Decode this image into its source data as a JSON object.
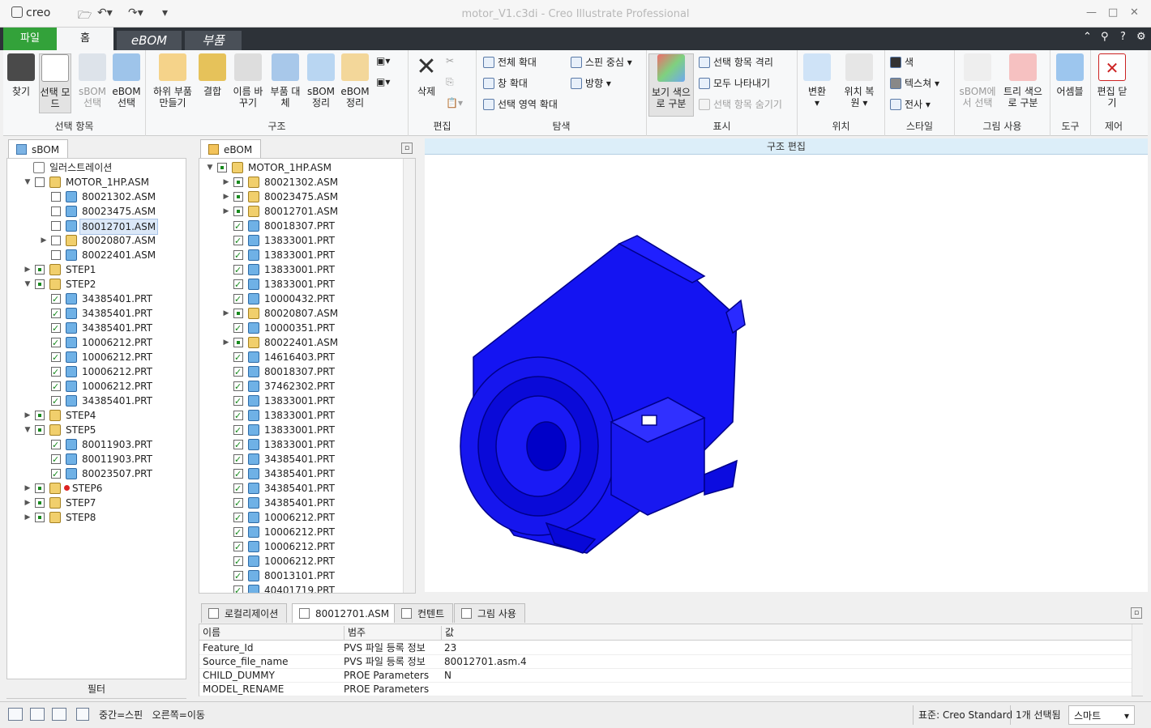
{
  "window": {
    "title": "motor_V1.c3di - Creo Illustrate Professional",
    "logo": "creo"
  },
  "tabs": [
    "파일",
    "홈",
    "eBOM",
    "부품"
  ],
  "ribbon": {
    "groups": [
      "선택 항목",
      "구조",
      "편집",
      "탐색",
      "표시",
      "위치",
      "스타일",
      "그림 사용",
      "도구",
      "제어"
    ],
    "buttons": {
      "find": "찾기",
      "select_mode": "선택 모\n드",
      "sbom_select": "sBOM\n선택",
      "ebom_select": "eBOM\n선택",
      "make_sub": "하위 부품\n만들기",
      "combine": "결합",
      "rename": "이름 바\n꾸기",
      "replace": "부품 대\n체",
      "sbom_arrange": "sBOM\n정리",
      "ebom_arrange": "eBOM\n정리",
      "delete": "삭제",
      "zoom_all": "전체 확대",
      "zoom_window": "창 확대",
      "zoom_selected": "선택 영역 확대",
      "spin_center": "스핀 중심",
      "orientation": "방향",
      "view_color": "보기 색으\n로 구분",
      "isolate": "선택 항목 격리",
      "show_all": "모두 나타내기",
      "hide_selected": "선택 항목 숨기기",
      "transform": "변환",
      "restore_pos": "위치 복\n원",
      "color": "색",
      "texture": "텍스쳐",
      "transfer": "전사",
      "select_in_sbom": "sBOM에\n서 선택",
      "tree_color": "트리 색으\n로 구분",
      "assembly": "어셈블",
      "close_edit": "편집 닫\n기"
    }
  },
  "sbom": {
    "tab": "sBOM",
    "rows": [
      {
        "label": "일러스트레이션",
        "level": 0,
        "tw": "",
        "cb": "",
        "icon": "stepi"
      },
      {
        "label": "MOTOR_1HP.ASM",
        "level": 1,
        "tw": "▼",
        "cb": "off",
        "icon": "asm"
      },
      {
        "label": "80021302.ASM",
        "level": 2,
        "tw": "",
        "cb": "off",
        "icon": "prt"
      },
      {
        "label": "80023475.ASM",
        "level": 2,
        "tw": "",
        "cb": "off",
        "icon": "prt"
      },
      {
        "label": "80012701.ASM",
        "level": 2,
        "tw": "",
        "cb": "off",
        "icon": "prt",
        "sel": true
      },
      {
        "label": "80020807.ASM",
        "level": 2,
        "tw": "▶",
        "cb": "off",
        "icon": "asm"
      },
      {
        "label": "80022401.ASM",
        "level": 2,
        "tw": "",
        "cb": "off",
        "icon": "prt"
      },
      {
        "label": "STEP1",
        "level": 1,
        "tw": "▶",
        "cb": "sq",
        "icon": "asm"
      },
      {
        "label": "STEP2",
        "level": 1,
        "tw": "▼",
        "cb": "sq",
        "icon": "asm"
      },
      {
        "label": "34385401.PRT",
        "level": 2,
        "tw": "",
        "cb": "on",
        "icon": "prt"
      },
      {
        "label": "34385401.PRT",
        "level": 2,
        "tw": "",
        "cb": "on",
        "icon": "prt"
      },
      {
        "label": "34385401.PRT",
        "level": 2,
        "tw": "",
        "cb": "on",
        "icon": "prt"
      },
      {
        "label": "10006212.PRT",
        "level": 2,
        "tw": "",
        "cb": "on",
        "icon": "prt"
      },
      {
        "label": "10006212.PRT",
        "level": 2,
        "tw": "",
        "cb": "on",
        "icon": "prt"
      },
      {
        "label": "10006212.PRT",
        "level": 2,
        "tw": "",
        "cb": "on",
        "icon": "prt"
      },
      {
        "label": "10006212.PRT",
        "level": 2,
        "tw": "",
        "cb": "on",
        "icon": "prt"
      },
      {
        "label": "34385401.PRT",
        "level": 2,
        "tw": "",
        "cb": "on",
        "icon": "prt"
      },
      {
        "label": "STEP4",
        "level": 1,
        "tw": "▶",
        "cb": "sq",
        "icon": "asm"
      },
      {
        "label": "STEP5",
        "level": 1,
        "tw": "▼",
        "cb": "sq",
        "icon": "asm"
      },
      {
        "label": "80011903.PRT",
        "level": 2,
        "tw": "",
        "cb": "on",
        "icon": "prt"
      },
      {
        "label": "80011903.PRT",
        "level": 2,
        "tw": "",
        "cb": "on",
        "icon": "prt"
      },
      {
        "label": "80023507.PRT",
        "level": 2,
        "tw": "",
        "cb": "on",
        "icon": "prt"
      },
      {
        "label": "STEP6",
        "level": 1,
        "tw": "▶",
        "cb": "sq",
        "icon": "asm",
        "dot": true
      },
      {
        "label": "STEP7",
        "level": 1,
        "tw": "▶",
        "cb": "sq",
        "icon": "asm"
      },
      {
        "label": "STEP8",
        "level": 1,
        "tw": "▶",
        "cb": "sq",
        "icon": "asm"
      }
    ],
    "filter": "필터"
  },
  "ebom": {
    "tab": "eBOM",
    "rows": [
      {
        "label": "MOTOR_1HP.ASM",
        "level": 0,
        "tw": "▼",
        "cb": "sq",
        "icon": "asm"
      },
      {
        "label": "80021302.ASM",
        "level": 1,
        "tw": "▶",
        "cb": "sq",
        "icon": "asm"
      },
      {
        "label": "80023475.ASM",
        "level": 1,
        "tw": "▶",
        "cb": "sq",
        "icon": "asm"
      },
      {
        "label": "80012701.ASM",
        "level": 1,
        "tw": "▶",
        "cb": "sq",
        "icon": "asm"
      },
      {
        "label": "80018307.PRT",
        "level": 1,
        "tw": "",
        "cb": "on",
        "icon": "prt"
      },
      {
        "label": "13833001.PRT",
        "level": 1,
        "tw": "",
        "cb": "on",
        "icon": "prt"
      },
      {
        "label": "13833001.PRT",
        "level": 1,
        "tw": "",
        "cb": "on",
        "icon": "prt"
      },
      {
        "label": "13833001.PRT",
        "level": 1,
        "tw": "",
        "cb": "on",
        "icon": "prt"
      },
      {
        "label": "13833001.PRT",
        "level": 1,
        "tw": "",
        "cb": "on",
        "icon": "prt"
      },
      {
        "label": "10000432.PRT",
        "level": 1,
        "tw": "",
        "cb": "on",
        "icon": "prt"
      },
      {
        "label": "80020807.ASM",
        "level": 1,
        "tw": "▶",
        "cb": "sq",
        "icon": "asm"
      },
      {
        "label": "10000351.PRT",
        "level": 1,
        "tw": "",
        "cb": "on",
        "icon": "prt"
      },
      {
        "label": "80022401.ASM",
        "level": 1,
        "tw": "▶",
        "cb": "sq",
        "icon": "asm"
      },
      {
        "label": "14616403.PRT",
        "level": 1,
        "tw": "",
        "cb": "on",
        "icon": "prt"
      },
      {
        "label": "80018307.PRT",
        "level": 1,
        "tw": "",
        "cb": "on",
        "icon": "prt"
      },
      {
        "label": "37462302.PRT",
        "level": 1,
        "tw": "",
        "cb": "on",
        "icon": "prt"
      },
      {
        "label": "13833001.PRT",
        "level": 1,
        "tw": "",
        "cb": "on",
        "icon": "prt"
      },
      {
        "label": "13833001.PRT",
        "level": 1,
        "tw": "",
        "cb": "on",
        "icon": "prt"
      },
      {
        "label": "13833001.PRT",
        "level": 1,
        "tw": "",
        "cb": "on",
        "icon": "prt"
      },
      {
        "label": "13833001.PRT",
        "level": 1,
        "tw": "",
        "cb": "on",
        "icon": "prt"
      },
      {
        "label": "34385401.PRT",
        "level": 1,
        "tw": "",
        "cb": "on",
        "icon": "prt"
      },
      {
        "label": "34385401.PRT",
        "level": 1,
        "tw": "",
        "cb": "on",
        "icon": "prt"
      },
      {
        "label": "34385401.PRT",
        "level": 1,
        "tw": "",
        "cb": "on",
        "icon": "prt"
      },
      {
        "label": "34385401.PRT",
        "level": 1,
        "tw": "",
        "cb": "on",
        "icon": "prt"
      },
      {
        "label": "10006212.PRT",
        "level": 1,
        "tw": "",
        "cb": "on",
        "icon": "prt"
      },
      {
        "label": "10006212.PRT",
        "level": 1,
        "tw": "",
        "cb": "on",
        "icon": "prt"
      },
      {
        "label": "10006212.PRT",
        "level": 1,
        "tw": "",
        "cb": "on",
        "icon": "prt"
      },
      {
        "label": "10006212.PRT",
        "level": 1,
        "tw": "",
        "cb": "on",
        "icon": "prt"
      },
      {
        "label": "80013101.PRT",
        "level": 1,
        "tw": "",
        "cb": "on",
        "icon": "prt"
      },
      {
        "label": "40401719.PRT",
        "level": 1,
        "tw": "",
        "cb": "on",
        "icon": "prt"
      }
    ]
  },
  "viewport": {
    "header": "구조 편집",
    "model_color": "#1010f0"
  },
  "bottom": {
    "tabs": [
      "로컬리제이션",
      "80012701.ASM",
      "컨텐트",
      "그림 사용"
    ],
    "columns": [
      "이름",
      "범주",
      "값"
    ],
    "rows": [
      [
        "Feature_Id",
        "PVS 파일 등록 정보",
        "23"
      ],
      [
        "Source_file_name",
        "PVS 파일 등록 정보",
        "80012701.asm.4"
      ],
      [
        "CHILD_DUMMY",
        "PROE Parameters",
        "N"
      ],
      [
        "MODEL_RENAME",
        "PROE Parameters",
        ""
      ]
    ]
  },
  "status": {
    "hint": "중간=스핀   오른쪽=이동",
    "standard": "표준: Creo Standard",
    "selected": "1개 선택됨",
    "mode": "스마트"
  }
}
